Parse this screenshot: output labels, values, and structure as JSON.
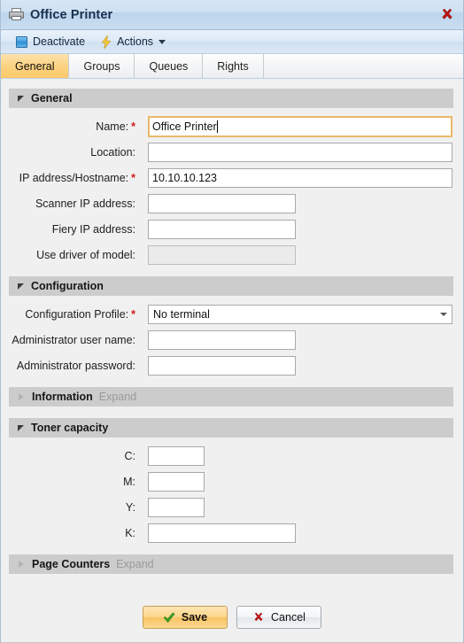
{
  "window": {
    "title": "Office Printer",
    "icon": "printer-icon",
    "close_icon": "close-icon"
  },
  "toolbar": {
    "items": [
      {
        "label": "Deactivate",
        "icon": "deactivate-square-icon",
        "has_caret": false
      },
      {
        "label": "Actions",
        "icon": "lightning-bolt-icon",
        "has_caret": true
      }
    ]
  },
  "tabs": [
    {
      "label": "General",
      "active": true
    },
    {
      "label": "Groups",
      "active": false
    },
    {
      "label": "Queues",
      "active": false
    },
    {
      "label": "Rights",
      "active": false
    }
  ],
  "sections": {
    "general": {
      "title": "General",
      "state": "expanded",
      "fields": [
        {
          "label": "Name:",
          "required": true,
          "value": "Office Printer",
          "placeholder": "",
          "width": "wide",
          "focused": true,
          "disabled": false
        },
        {
          "label": "Location:",
          "required": false,
          "value": "",
          "placeholder": "",
          "width": "wide",
          "focused": false,
          "disabled": false
        },
        {
          "label": "IP address/Hostname:",
          "required": true,
          "value": "10.10.10.123",
          "placeholder": "",
          "width": "wide",
          "focused": false,
          "disabled": false
        },
        {
          "label": "Scanner IP address:",
          "required": false,
          "value": "",
          "placeholder": "",
          "width": "mid",
          "focused": false,
          "disabled": false
        },
        {
          "label": "Fiery IP address:",
          "required": false,
          "value": "",
          "placeholder": "",
          "width": "mid",
          "focused": false,
          "disabled": false
        },
        {
          "label": "Use driver of model:",
          "required": false,
          "value": "",
          "placeholder": "",
          "width": "mid",
          "focused": false,
          "disabled": true
        }
      ]
    },
    "configuration": {
      "title": "Configuration",
      "state": "expanded",
      "profile_label": "Configuration Profile:",
      "profile_required": true,
      "profile_value": "No terminal",
      "profile_options": [
        "No terminal"
      ],
      "fields": [
        {
          "label": "Administrator user name:",
          "required": false,
          "value": "",
          "placeholder": "",
          "width": "mid",
          "focused": false,
          "disabled": false
        },
        {
          "label": "Administrator password:",
          "required": false,
          "value": "",
          "placeholder": "",
          "width": "mid",
          "focused": false,
          "disabled": false
        }
      ]
    },
    "information": {
      "title": "Information",
      "state": "collapsed",
      "expand_label": "Expand"
    },
    "toner": {
      "title": "Toner capacity",
      "state": "expanded",
      "fields": [
        {
          "label": "C:",
          "required": false,
          "value": "",
          "placeholder": "",
          "width": "small",
          "focused": false,
          "disabled": false
        },
        {
          "label": "M:",
          "required": false,
          "value": "",
          "placeholder": "",
          "width": "small",
          "focused": false,
          "disabled": false
        },
        {
          "label": "Y:",
          "required": false,
          "value": "",
          "placeholder": "",
          "width": "small",
          "focused": false,
          "disabled": false
        },
        {
          "label": "K:",
          "required": false,
          "value": "",
          "placeholder": "",
          "width": "mid",
          "focused": false,
          "disabled": false
        }
      ]
    },
    "page_counters": {
      "title": "Page Counters",
      "state": "collapsed",
      "expand_label": "Expand"
    }
  },
  "footer": {
    "save_label": "Save",
    "save_icon": "green-check-icon",
    "cancel_label": "Cancel",
    "cancel_icon": "red-x-icon"
  },
  "colors": {
    "accent": "#fbc96a",
    "required": "#d11919",
    "section_header": "#cccccc",
    "background": "#f0f0f0",
    "focus_border": "#e8b96a"
  }
}
